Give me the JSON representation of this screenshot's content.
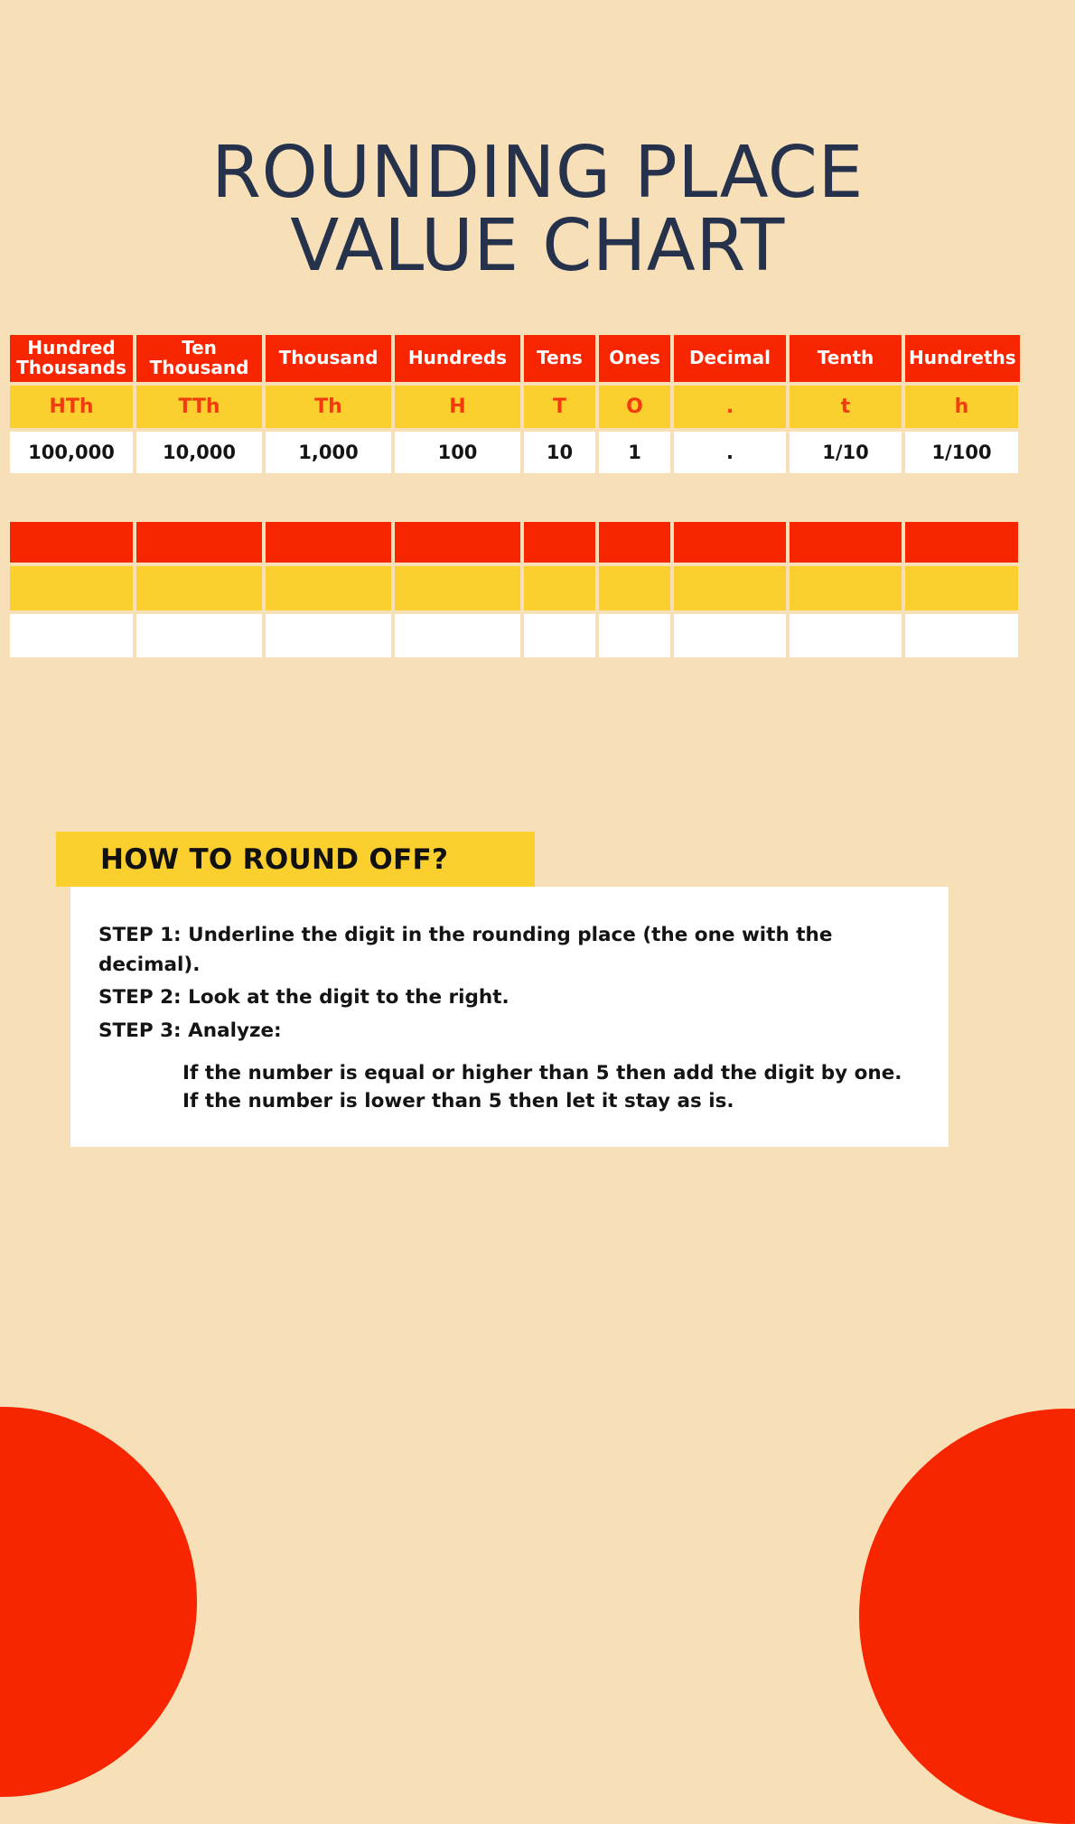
{
  "page": {
    "title_line1": "ROUNDING PLACE",
    "title_line2": "VALUE CHART",
    "background_color": "#F7DFB8",
    "accent_red": "#F72500",
    "accent_yellow": "#FBD02E",
    "title_color": "#26324B"
  },
  "place_value_table": {
    "columns": [
      {
        "name": "Hundred Thousands",
        "abbr": "HTh",
        "value": "100,000"
      },
      {
        "name": "Ten Thousand",
        "abbr": "TTh",
        "value": "10,000"
      },
      {
        "name": "Thousand",
        "abbr": "Th",
        "value": "1,000"
      },
      {
        "name": "Hundreds",
        "abbr": "H",
        "value": "100"
      },
      {
        "name": "Tens",
        "abbr": "T",
        "value": "10"
      },
      {
        "name": "Ones",
        "abbr": "O",
        "value": "1"
      },
      {
        "name": "Decimal",
        "abbr": ".",
        "value": "."
      },
      {
        "name": "Tenth",
        "abbr": "t",
        "value": "1/10"
      },
      {
        "name": "Hundreths",
        "abbr": "h",
        "value": "1/100"
      }
    ]
  },
  "blank_table": {
    "columns": [
      {
        "name": "",
        "abbr": "",
        "value": ""
      },
      {
        "name": "",
        "abbr": "",
        "value": ""
      },
      {
        "name": "",
        "abbr": "",
        "value": ""
      },
      {
        "name": "",
        "abbr": "",
        "value": ""
      },
      {
        "name": "",
        "abbr": "",
        "value": ""
      },
      {
        "name": "",
        "abbr": "",
        "value": ""
      },
      {
        "name": "",
        "abbr": "",
        "value": ""
      },
      {
        "name": "",
        "abbr": "",
        "value": ""
      },
      {
        "name": "",
        "abbr": "",
        "value": ""
      }
    ]
  },
  "howto": {
    "heading": "HOW TO ROUND OFF?",
    "step1": "STEP 1: Underline the digit in the rounding place (the one with the decimal).",
    "step2": "STEP 2: Look at the digit to the right.",
    "step3": "STEP 3: Analyze:",
    "rule1": "If the number is equal or higher than 5 then add the digit by one.",
    "rule2": "If the number is lower than 5 then let it stay as is."
  }
}
